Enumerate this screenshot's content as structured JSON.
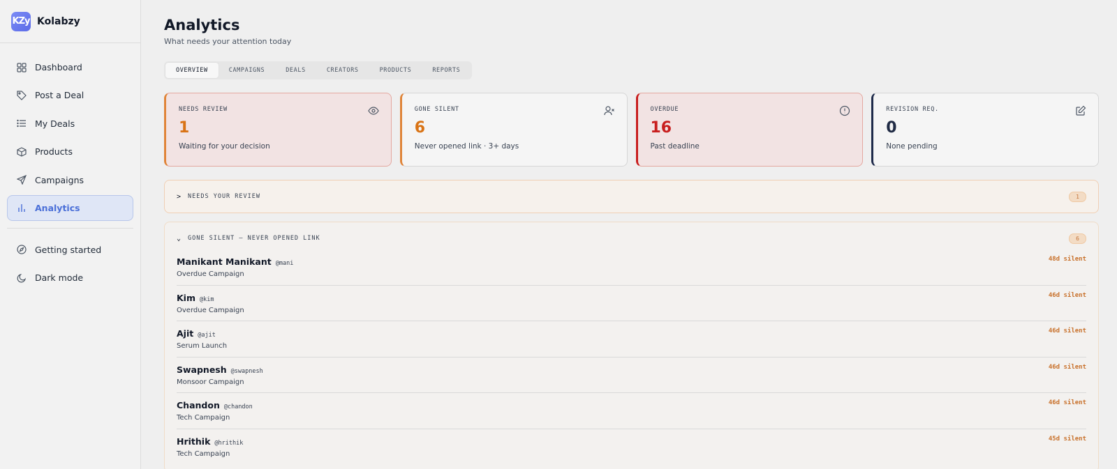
{
  "brand": {
    "name": "Kolabzy",
    "logo_text": "KZy"
  },
  "sidebar": {
    "items": [
      {
        "label": "Dashboard",
        "icon": "grid-icon"
      },
      {
        "label": "Post a Deal",
        "icon": "tag-icon"
      },
      {
        "label": "My Deals",
        "icon": "list-icon"
      },
      {
        "label": "Products",
        "icon": "box-icon"
      },
      {
        "label": "Campaigns",
        "icon": "send-icon"
      },
      {
        "label": "Analytics",
        "icon": "bar-chart-icon",
        "active": true
      }
    ],
    "secondary": [
      {
        "label": "Getting started",
        "icon": "compass-icon"
      },
      {
        "label": "Dark mode",
        "icon": "moon-icon"
      }
    ]
  },
  "header": {
    "title": "Analytics",
    "subtitle": "What needs your attention today"
  },
  "tabs": [
    "OVERVIEW",
    "CAMPAIGNS",
    "DEALS",
    "CREATORS",
    "PRODUCTS",
    "REPORTS"
  ],
  "cards": [
    {
      "label": "NEEDS REVIEW",
      "value": "1",
      "desc": "Waiting for your decision",
      "icon": "eye-icon",
      "color": "#d97315"
    },
    {
      "label": "GONE SILENT",
      "value": "6",
      "desc": "Never opened link · 3+ days",
      "icon": "user-x-icon",
      "color": "#d97315"
    },
    {
      "label": "OVERDUE",
      "value": "16",
      "desc": "Past deadline",
      "icon": "alert-circle-icon",
      "color": "#c81e1e"
    },
    {
      "label": "REVISION REQ.",
      "value": "0",
      "desc": "None pending",
      "icon": "edit-icon",
      "color": "#1f2a44"
    }
  ],
  "review_panel": {
    "title": "NEEDS YOUR REVIEW",
    "count": "1",
    "chevron": ">"
  },
  "silent_panel": {
    "title": "GONE SILENT — NEVER OPENED LINK",
    "count": "6",
    "chevron": "⌄",
    "rows": [
      {
        "name": "Manikant Manikant",
        "handle": "@mani",
        "campaign": "Overdue Campaign",
        "silent": "48d silent"
      },
      {
        "name": "Kim",
        "handle": "@kim",
        "campaign": "Overdue Campaign",
        "silent": "46d silent"
      },
      {
        "name": "Ajit",
        "handle": "@ajit",
        "campaign": "Serum Launch",
        "silent": "46d silent"
      },
      {
        "name": "Swapnesh",
        "handle": "@swapnesh",
        "campaign": "Monsoor Campaign",
        "silent": "46d silent"
      },
      {
        "name": "Chandon",
        "handle": "@chandon",
        "campaign": "Tech Campaign",
        "silent": "46d silent"
      },
      {
        "name": "Hrithik",
        "handle": "@hrithik",
        "campaign": "Tech Campaign",
        "silent": "45d silent"
      }
    ]
  }
}
